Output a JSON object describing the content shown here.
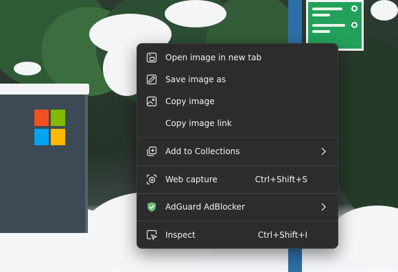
{
  "menu": {
    "items": [
      {
        "label": "Open image in new tab",
        "icon": "open-new-tab-icon"
      },
      {
        "label": "Save image as",
        "icon": "save-image-icon"
      },
      {
        "label": "Copy image",
        "icon": "copy-image-icon"
      },
      {
        "label": "Copy image link",
        "icon": ""
      },
      {
        "label": "Add to Collections",
        "icon": "add-collections-icon",
        "submenu": true
      },
      {
        "label": "Web capture",
        "icon": "web-capture-icon",
        "shortcut": "Ctrl+Shift+S"
      },
      {
        "label": "AdGuard AdBlocker",
        "icon": "adguard-shield-icon",
        "submenu": true
      },
      {
        "label": "Inspect",
        "icon": "inspect-icon",
        "shortcut": "Ctrl+Shift+I"
      }
    ]
  },
  "colors": {
    "menu_bg": "#2c2c2c",
    "text": "#f2f2f2",
    "separator": "#454545",
    "adguard_green": "#68bc71"
  }
}
